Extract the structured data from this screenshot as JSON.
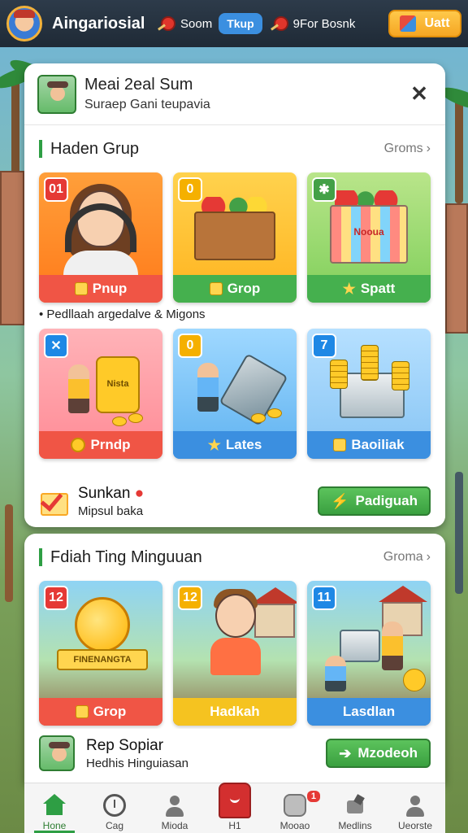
{
  "topbar": {
    "title": "Aingariosial",
    "item1_label": "Soom",
    "item1_pill": "Tkup",
    "item2_label": "9For Bosnk",
    "visit_label": "Uatt"
  },
  "panel": {
    "title": "Meai 2eal Sum",
    "subtitle": "Suraep Gani teupavia",
    "close_label": "✕"
  },
  "section1": {
    "title": "Haden Grup",
    "link": "Groms",
    "note": "Pedllaah argedalve & Migons",
    "cards": [
      {
        "badge": "01",
        "label": "Pnup",
        "box_label": ""
      },
      {
        "badge": "0",
        "label": "Grop",
        "box_label": ""
      },
      {
        "badge": "",
        "label": "Spatt",
        "box_label": "Nooua"
      },
      {
        "badge": "",
        "label": "Prndp",
        "box_label": "Nista"
      },
      {
        "badge": "0",
        "label": "Lates",
        "box_label": ""
      },
      {
        "badge": "7",
        "label": "Baoiliak",
        "box_label": ""
      }
    ]
  },
  "row1": {
    "title": "Sunkan",
    "subtitle": "Mipsul baka",
    "button": "Padiguah"
  },
  "section2": {
    "title": "Fdiah Ting Minguuan",
    "link": "Groma",
    "cards": [
      {
        "badge": "12",
        "label": "Grop",
        "banner": "FINENANGTA"
      },
      {
        "badge": "12",
        "label": "Hadkah",
        "banner": ""
      },
      {
        "badge": "11",
        "label": "Lasdlan",
        "banner": ""
      }
    ]
  },
  "row2": {
    "title": "Rep Sopiar",
    "subtitle": "Hedhis Hinguiasan",
    "button": "Mzodeoh"
  },
  "nav": {
    "items": [
      {
        "label": "Hone"
      },
      {
        "label": "Cag"
      },
      {
        "label": "Mioda"
      },
      {
        "label": "H1"
      },
      {
        "label": "Mooao",
        "badge": "1"
      },
      {
        "label": "Medlins"
      },
      {
        "label": "Ueorste"
      }
    ]
  },
  "colors": {
    "accent_green": "#2e9e44",
    "accent_blue": "#3b8fe0",
    "accent_orange": "#f5a623",
    "danger_red": "#e53935"
  }
}
